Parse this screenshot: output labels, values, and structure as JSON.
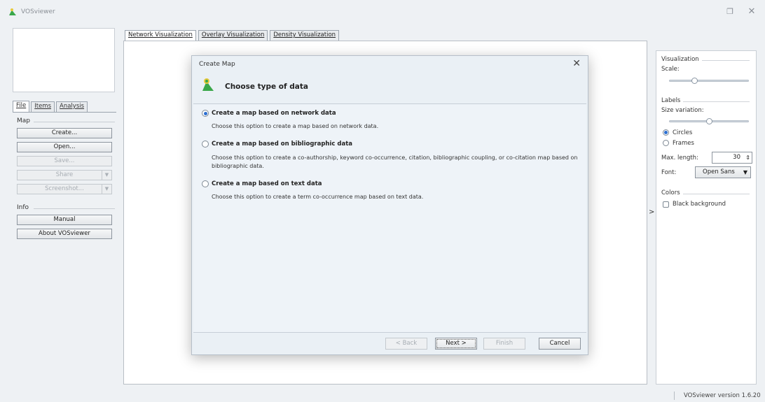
{
  "window": {
    "title": "VOSviewer",
    "restore_glyph": "❐",
    "close_glyph": "✕"
  },
  "left_panel": {
    "tabs": [
      {
        "label": "File"
      },
      {
        "label": "Items"
      },
      {
        "label": "Analysis"
      }
    ],
    "map_section": "Map",
    "map_buttons": [
      {
        "label": "Create..."
      },
      {
        "label": "Open..."
      },
      {
        "label": "Save..."
      },
      {
        "label": "Share"
      },
      {
        "label": "Screenshot..."
      }
    ],
    "info_section": "Info",
    "info_buttons": [
      {
        "label": "Manual"
      },
      {
        "label": "About VOSviewer"
      }
    ]
  },
  "main_tabs": [
    {
      "label": "Network Visualization"
    },
    {
      "label": "Overlay Visualization"
    },
    {
      "label": "Density Visualization"
    }
  ],
  "expand_arrow": ">",
  "right_panel": {
    "visualization_header": "Visualization",
    "scale_label": "Scale:",
    "scale_value": 0.3,
    "labels_header": "Labels",
    "size_variation_label": "Size variation:",
    "size_variation_value": 0.5,
    "circles_label": "Circles",
    "frames_label": "Frames",
    "max_length_label": "Max. length:",
    "max_length_value": "30",
    "font_label": "Font:",
    "font_value": "Open Sans",
    "colors_header": "Colors",
    "black_background_label": "Black background"
  },
  "status_bar": {
    "version": "VOSviewer version 1.6.20"
  },
  "dialog": {
    "title": "Create Map",
    "heading": "Choose type of data",
    "options": [
      {
        "title": "Create a map based on network data",
        "description": "Choose this option to create a map based on network data.",
        "selected": true
      },
      {
        "title": "Create a map based on bibliographic data",
        "description": "Choose this option to create a co-authorship, keyword co-occurrence, citation, bibliographic coupling, or co-citation map based on bibliographic data.",
        "selected": false
      },
      {
        "title": "Create a map based on text data",
        "description": "Choose this option to create a term co-occurrence map based on text data.",
        "selected": false
      }
    ],
    "buttons": {
      "back": "< Back",
      "next": "Next >",
      "finish": "Finish",
      "cancel": "Cancel"
    }
  },
  "colors": {
    "accent": "#2c6fd1",
    "logo_green": "#3aa74a",
    "logo_yellow": "#e8c93a"
  }
}
